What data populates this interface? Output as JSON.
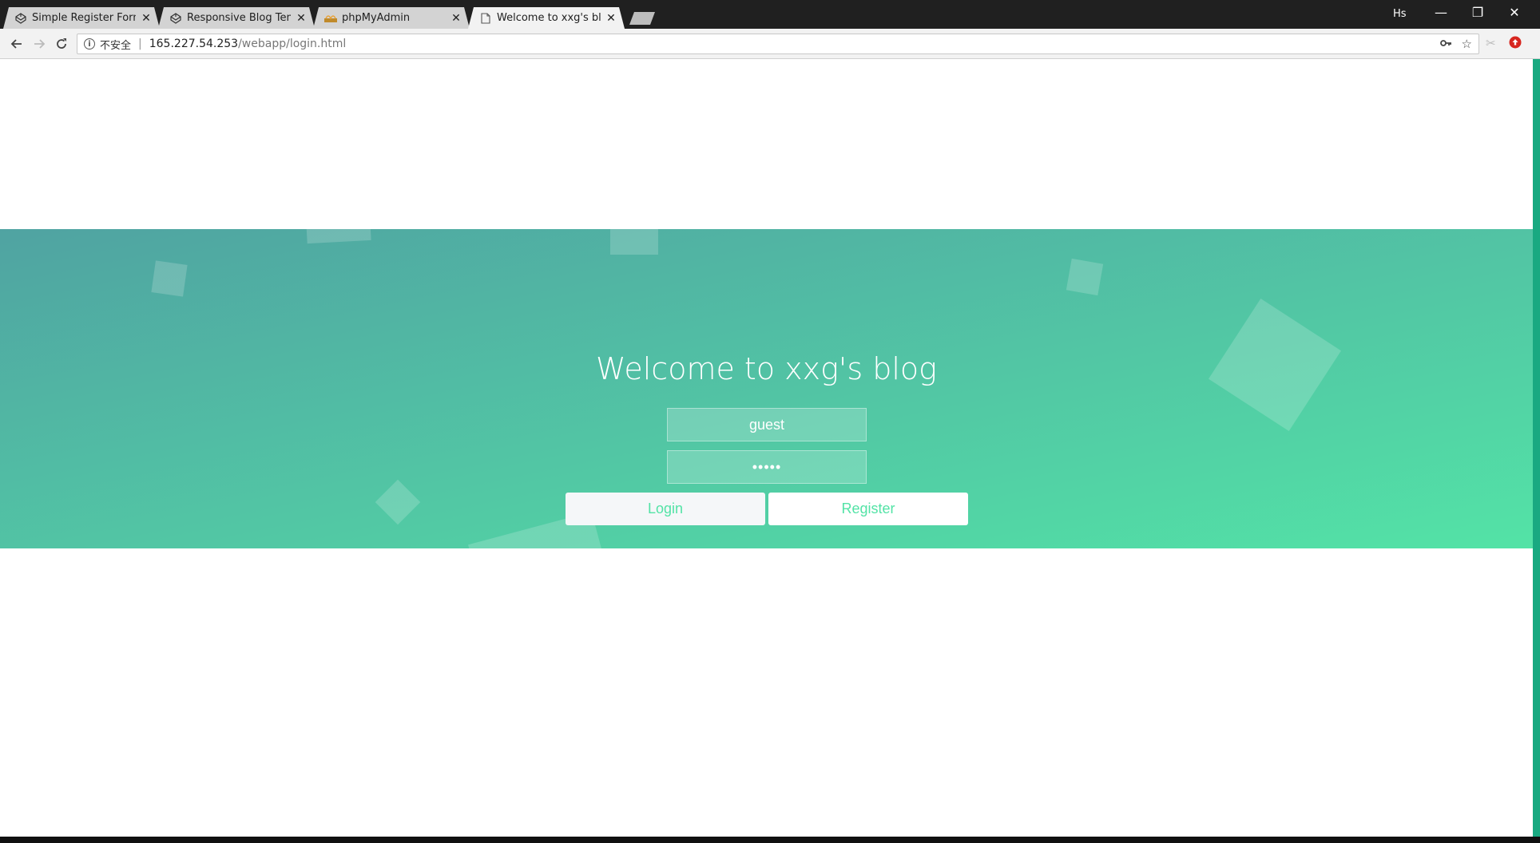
{
  "browser": {
    "tabs": [
      {
        "title": "Simple Register Form w",
        "icon": "codepen-icon",
        "active": false
      },
      {
        "title": "Responsive Blog Templ",
        "icon": "codepen-icon",
        "active": false
      },
      {
        "title": "phpMyAdmin",
        "icon": "phpmyadmin-icon",
        "active": false
      },
      {
        "title": "Welcome to xxg's blog",
        "icon": "document-icon",
        "active": true
      }
    ],
    "profile": "Hs",
    "address": {
      "security_label": "不安全",
      "host": "165.227.54.253",
      "path": "/webapp/login.html"
    }
  },
  "page": {
    "title": "Welcome to xxg's blog",
    "username_value": "guest",
    "password_value": "•••••",
    "login_label": "Login",
    "register_label": "Register"
  },
  "colors": {
    "gradient_start": "#50a3a2",
    "gradient_end": "#53e3a6",
    "button_text": "#53e3a6"
  }
}
